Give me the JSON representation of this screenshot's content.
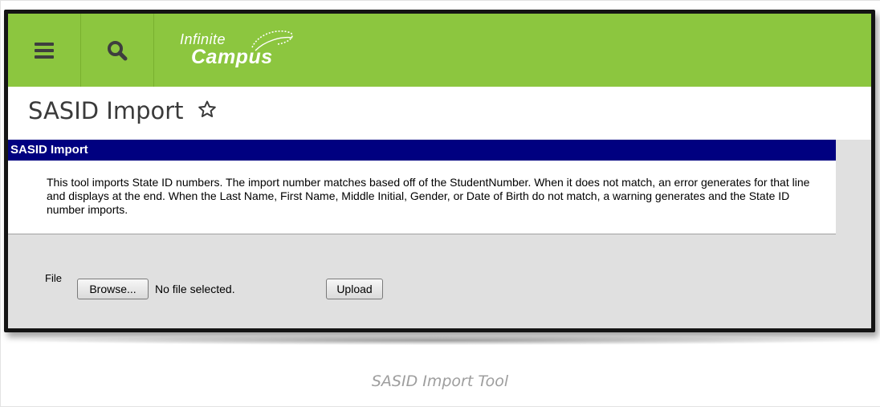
{
  "header": {
    "menu_icon": "hamburger-icon",
    "search_icon": "search-icon",
    "logo_line1": "Infinite",
    "logo_line2": "Campus",
    "brand_color": "#8cc63f"
  },
  "page": {
    "title": "SASID Import",
    "favorite_icon": "star-outline-icon"
  },
  "panel": {
    "header": "SASID Import",
    "header_color": "#000080",
    "description": "This tool imports State ID numbers. The import number matches based off of the StudentNumber. When it does not match, an error generates for that line and displays at the end. When the Last Name, First Name, Middle Initial, Gender, or Date of Birth do not match, a warning generates and the State ID number imports."
  },
  "form": {
    "file_label": "File",
    "browse_label": "Browse...",
    "file_status": "No file selected.",
    "upload_label": "Upload"
  },
  "caption": "SASID Import Tool"
}
